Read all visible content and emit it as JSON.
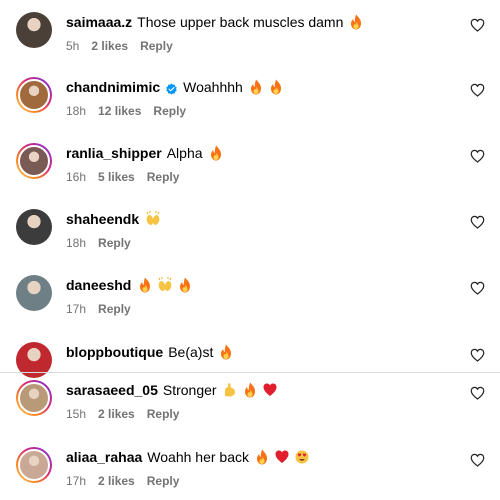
{
  "comments": [
    {
      "username": "saimaaa.z",
      "verified": false,
      "text": "Those upper back muscles damn",
      "emojis": [
        "fire"
      ],
      "time": "5h",
      "likes": "2 likes",
      "reply": "Reply",
      "avatar_icon": "avatar-photo",
      "avatar_color": "#4a4038",
      "ring": false
    },
    {
      "username": "chandnimimic",
      "verified": true,
      "text": "Woahhhh",
      "emojis": [
        "fire",
        "fire"
      ],
      "time": "18h",
      "likes": "12 likes",
      "reply": "Reply",
      "avatar_icon": "avatar-photo",
      "avatar_color": "#a06a3c",
      "ring": true
    },
    {
      "username": "ranlia_shipper",
      "verified": false,
      "text": "Alpha",
      "emojis": [
        "fire"
      ],
      "time": "16h",
      "likes": "5 likes",
      "reply": "Reply",
      "avatar_icon": "avatar-photo",
      "avatar_color": "#7a5a55",
      "ring": true
    },
    {
      "username": "shaheendk",
      "verified": false,
      "text": "",
      "emojis": [
        "raised-hands"
      ],
      "time": "18h",
      "likes": "",
      "reply": "Reply",
      "avatar_icon": "avatar-photo",
      "avatar_color": "#3c3c3c",
      "ring": false
    },
    {
      "username": "daneeshd",
      "verified": false,
      "text": "",
      "emojis": [
        "fire",
        "raised-hands",
        "fire"
      ],
      "time": "17h",
      "likes": "",
      "reply": "Reply",
      "avatar_icon": "avatar-photo",
      "avatar_color": "#6e7f86",
      "ring": false
    },
    {
      "username": "bloppboutique",
      "verified": false,
      "text": "Be(a)st",
      "emojis": [
        "fire"
      ],
      "time": "",
      "likes": "",
      "reply": "",
      "avatar_icon": "avatar-photo",
      "avatar_color": "#c0282f",
      "ring": false
    },
    {
      "username": "sarasaeed_05",
      "verified": false,
      "text": "Stronger",
      "emojis": [
        "flexed-biceps",
        "fire",
        "red-heart"
      ],
      "time": "15h",
      "likes": "2 likes",
      "reply": "Reply",
      "avatar_icon": "avatar-photo",
      "avatar_color": "#b89a78",
      "ring": true
    },
    {
      "username": "aliaa_rahaa",
      "verified": false,
      "text": "Woahh her back",
      "emojis": [
        "fire",
        "red-heart",
        "heart-eyes"
      ],
      "time": "17h",
      "likes": "2 likes",
      "reply": "Reply",
      "avatar_icon": "avatar-photo",
      "avatar_color": "#c9a896",
      "ring": true
    }
  ],
  "like_icon": "heart-outline-icon",
  "colors": {
    "meta_text": "#737373",
    "verified": "#0095f6",
    "divider": "#dbdbdb",
    "fire": "#f97316",
    "heart": "#e11d2e"
  }
}
